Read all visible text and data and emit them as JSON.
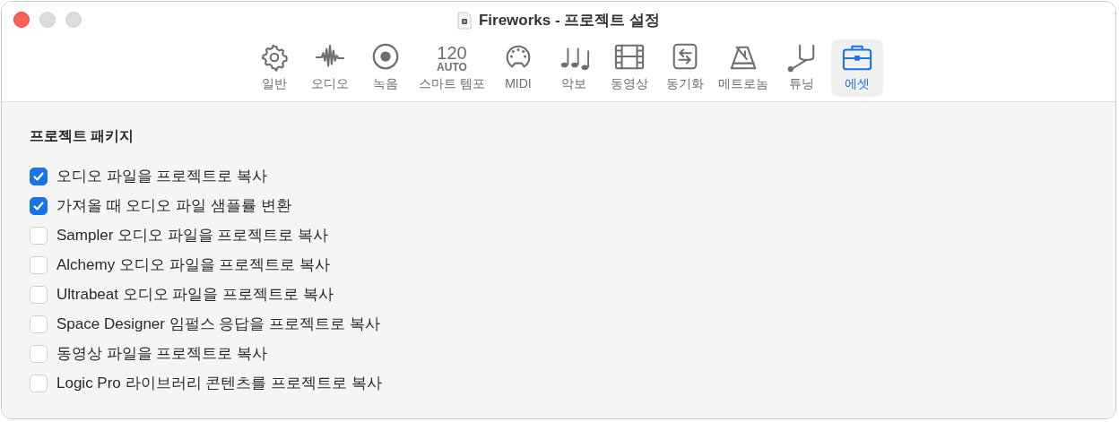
{
  "window": {
    "title": "Fireworks - 프로젝트 설정"
  },
  "tabs": [
    {
      "kind": "gear",
      "label": "일반",
      "selected": false
    },
    {
      "kind": "wave",
      "label": "오디오",
      "selected": false
    },
    {
      "kind": "record",
      "label": "녹음",
      "selected": false
    },
    {
      "kind": "tempo",
      "value": "120",
      "mode": "AUTO",
      "label": "스마트 템포",
      "selected": false
    },
    {
      "kind": "midi",
      "label": "MIDI",
      "selected": false
    },
    {
      "kind": "notes",
      "label": "악보",
      "selected": false
    },
    {
      "kind": "film",
      "label": "동영상",
      "selected": false
    },
    {
      "kind": "sync",
      "label": "동기화",
      "selected": false
    },
    {
      "kind": "metronome",
      "label": "메트로놈",
      "selected": false
    },
    {
      "kind": "fork",
      "label": "튜닝",
      "selected": false
    },
    {
      "kind": "briefcase",
      "label": "에셋",
      "selected": true
    }
  ],
  "section": {
    "title": "프로젝트 패키지"
  },
  "options": [
    {
      "label": "오디오 파일을 프로젝트로 복사",
      "checked": true
    },
    {
      "label": "가져올 때 오디오 파일 샘플률 변환",
      "checked": true
    },
    {
      "label": "Sampler 오디오 파일을 프로젝트로 복사",
      "checked": false
    },
    {
      "label": "Alchemy 오디오 파일을 프로젝트로 복사",
      "checked": false
    },
    {
      "label": "Ultrabeat 오디오 파일을 프로젝트로 복사",
      "checked": false
    },
    {
      "label": "Space Designer 임펄스 응답을 프로젝트로 복사",
      "checked": false
    },
    {
      "label": "동영상 파일을 프로젝트로 복사",
      "checked": false
    },
    {
      "label": "Logic Pro 라이브러리 콘텐츠를 프로젝트로 복사",
      "checked": false
    }
  ]
}
